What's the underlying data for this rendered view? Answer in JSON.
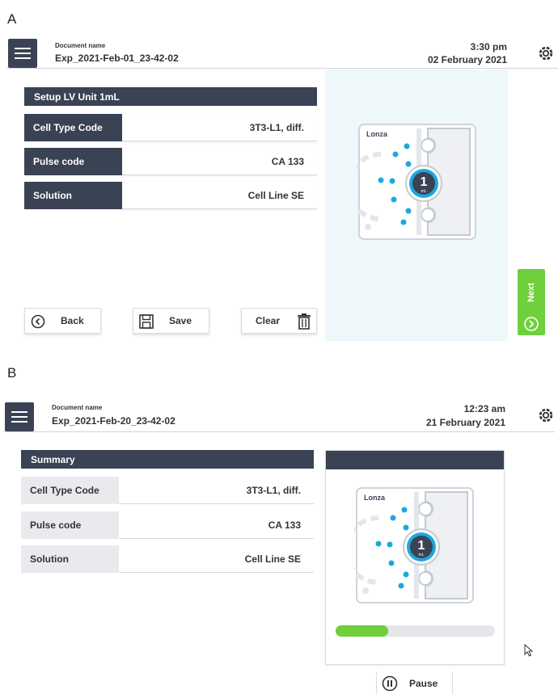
{
  "panels": [
    {
      "letter": "A"
    },
    {
      "letter": "B"
    }
  ],
  "screenA": {
    "doc_label": "Document name",
    "doc_name": "Exp_2021-Feb-01_23-42-02",
    "time": "3:30 pm",
    "date": "02 February 2021",
    "section_title": "Setup LV Unit 1mL",
    "rows": [
      {
        "label": "Cell Type Code",
        "value": "3T3-L1, diff."
      },
      {
        "label": "Pulse code",
        "value": "CA 133"
      },
      {
        "label": "Solution",
        "value": "Cell Line SE"
      }
    ],
    "buttons": {
      "back": "Back",
      "save": "Save",
      "clear": "Clear",
      "next": "Next"
    },
    "cuvette": {
      "brand": "Lonza",
      "volume": "1",
      "unit": "mL"
    }
  },
  "screenB": {
    "doc_label": "Document name",
    "doc_name": "Exp_2021-Feb-20_23-42-02",
    "time": "12:23 am",
    "date": "21 February 2021",
    "section_title": "Summary",
    "rows": [
      {
        "label": "Cell Type Code",
        "value": "3T3-L1, diff."
      },
      {
        "label": "Pulse code",
        "value": "CA 133"
      },
      {
        "label": "Solution",
        "value": "Cell Line SE"
      }
    ],
    "cuvette": {
      "brand": "Lonza",
      "volume": "1",
      "unit": "mL"
    },
    "progress_fraction": 0.33,
    "buttons": {
      "pause": "Pause"
    }
  },
  "colors": {
    "header": "#3a4354",
    "accent_green": "#6fcf3c",
    "accent_blue": "#1da7e0",
    "cuvette_bg": "#eef8fb"
  },
  "icons": [
    "menu-icon",
    "gear-icon",
    "back-arrow-icon",
    "save-icon",
    "trash-icon",
    "next-arrow-icon",
    "pause-icon",
    "mouse-cursor-icon"
  ]
}
